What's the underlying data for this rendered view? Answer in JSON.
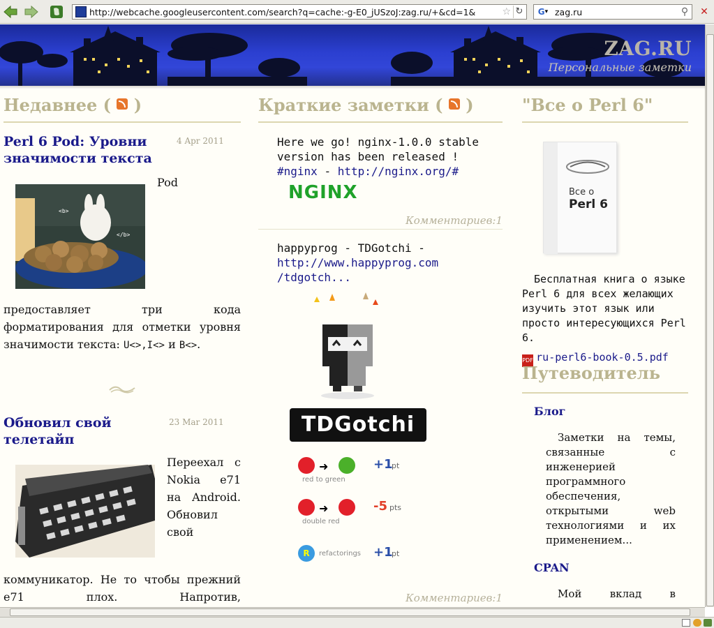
{
  "browser": {
    "url": "http://webcache.googleusercontent.com/search?q=cache:-g-E0_jUSzoJ:zag.ru/+&cd=1&",
    "search_query": "zag.ru"
  },
  "site": {
    "title": "ZAG.RU",
    "subtitle": "Персональные заметки"
  },
  "recent": {
    "heading_open": "Недавнее (",
    "heading_close": ")",
    "posts": [
      {
        "title": "Perl 6 Pod: Уровни значимости текста",
        "date": "4 Apr 2011",
        "text_first": "Pod",
        "text_rest": "предоставляет три кода форматирования для отметки уровня значимости текста:",
        "code": "U<>,I<>",
        "text_and": "и",
        "code2": "B<>",
        "text_end": "."
      },
      {
        "title": "Обновил свой телетайп",
        "date": "23 Mar 2011",
        "text_lines": [
          "Переехал с",
          "Nokia e71",
          "на Android.",
          "Обновил",
          "свой"
        ],
        "text_rest": "коммуникатор. Не то чтобы прежний e71 плох. Напротив,"
      }
    ],
    "image_labels": {
      "b_tag": "<b>",
      "b_close": "</b>"
    }
  },
  "notes": {
    "heading_open": "Краткие заметки (",
    "heading_close": ")",
    "items": [
      {
        "text": "Here we go! nginx-1.0.0 stable version has been released !",
        "tag": "#nginx",
        "dash": "-",
        "link": "http://nginx.org/#",
        "logo": "NGINX",
        "comments": "Комментариев:1"
      },
      {
        "text": "happyprog - TDGotchi -",
        "link_line1": "http://www.happyprog.com",
        "link_line2": "/tdgotch...",
        "logo": "TDGotchi",
        "rows": [
          {
            "caption": "red to green",
            "points": "+1",
            "unit": "pt"
          },
          {
            "caption": "double red",
            "points": "-5",
            "unit": "pts"
          },
          {
            "caption": "refactorings",
            "points": "+1",
            "unit": "pt"
          }
        ],
        "comments": "Комментариев:1"
      }
    ]
  },
  "book": {
    "heading": "\"Все о Perl 6\"",
    "cover_line1": "Все о",
    "cover_line2": "Perl 6",
    "description": "Бесплатная книга о языке Perl 6 для всех желающих изучить этот язык или просто интересующихся Perl 6.",
    "pdf_link": "ru-perl6-book-0.5.pdf"
  },
  "guide": {
    "heading": "Путеводитель",
    "sections": [
      {
        "title": "Блог",
        "text": "Заметки на темы, связанные с инженерией программного обеспечения, открытыми web технологиями и их применением..."
      },
      {
        "title": "CPAN",
        "text": "Мой вклад в"
      }
    ]
  },
  "colors": {
    "heading": "#bab48f",
    "link": "#1a1a8a",
    "banner": "#2b3fd0"
  }
}
